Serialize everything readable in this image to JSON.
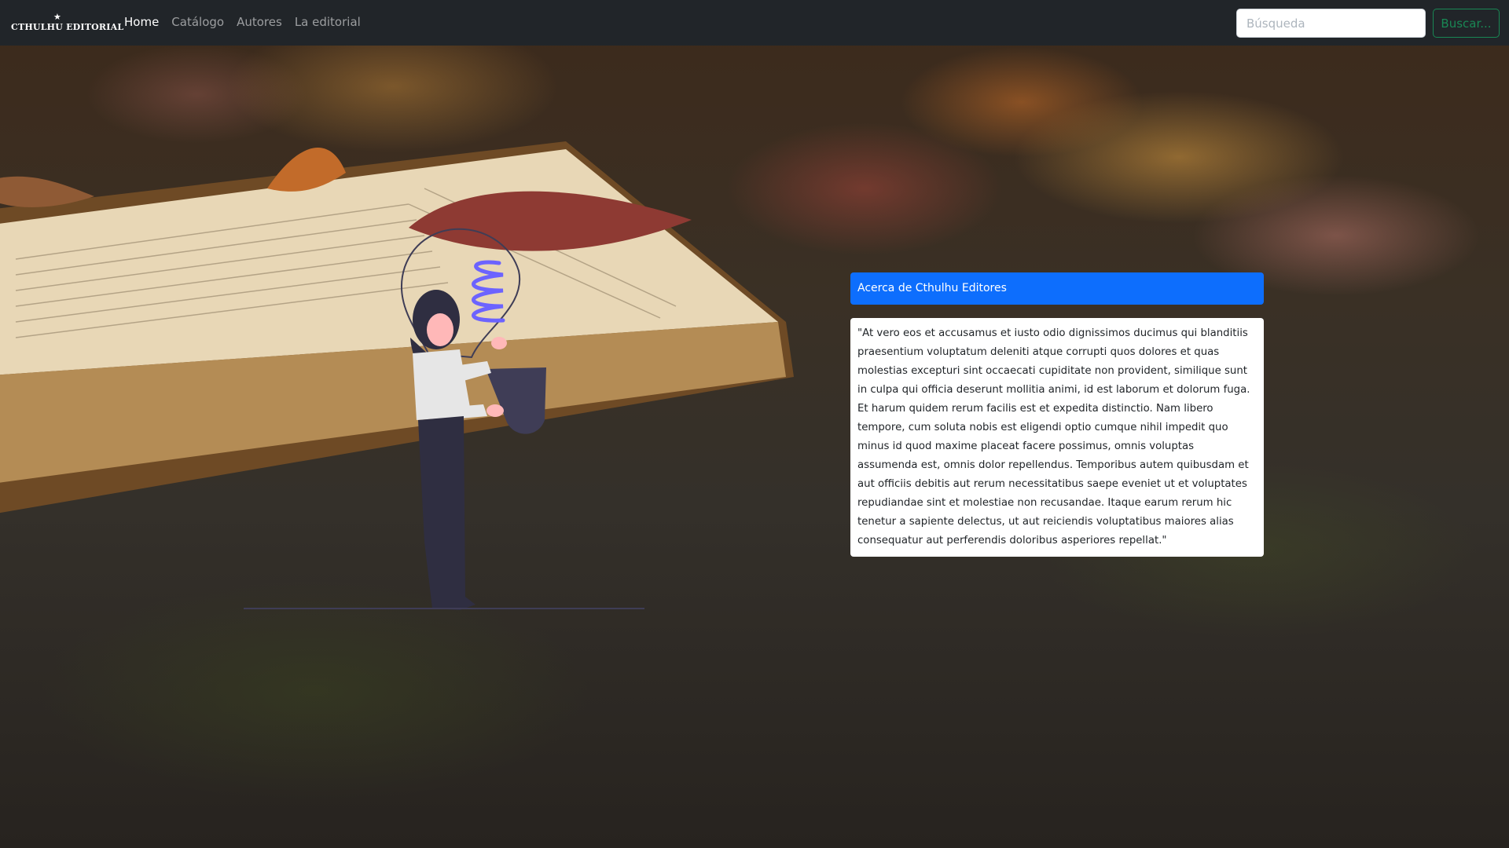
{
  "navbar": {
    "brand": "CTHULHU EDITORIAL",
    "brand_icon": "star-icon",
    "links": [
      {
        "label": "Home",
        "active": true
      },
      {
        "label": "Catálogo",
        "active": false
      },
      {
        "label": "Autores",
        "active": false
      },
      {
        "label": "La editorial",
        "active": false
      }
    ],
    "search": {
      "placeholder": "Búsqueda",
      "value": ""
    },
    "search_button": "Buscar..."
  },
  "card": {
    "header": "Acerca de Cthulhu Editores",
    "body": "\"At vero eos et accusamus et iusto odio dignissimos ducimus qui blanditiis praesentium voluptatum deleniti atque corrupti quos dolores et quas molestias excepturi sint occaecati cupiditate non provident, similique sunt in culpa qui officia deserunt mollitia animi, id est laborum et dolorum fuga. Et harum quidem rerum facilis est et expedita distinctio. Nam libero tempore, cum soluta nobis est eligendi optio cumque nihil impedit quo minus id quod maxime placeat facere possimus, omnis voluptas assumenda est, omnis dolor repellendus. Temporibus autem quibusdam et aut officiis debitis aut rerum necessitatibus saepe eveniet ut et voluptates repudiandae sint et molestiae non recusandae. Itaque earum rerum hic tenetur a sapiente delectus, ut aut reiciendis voluptatibus maiores alias consequatur aut perferendis doloribus asperiores repellat.\""
  },
  "colors": {
    "navbar_bg": "#212529",
    "card_header_bg": "#0d6efd",
    "search_button": "#198754",
    "illustration_accent": "#6c63ff",
    "illustration_dark": "#3f3d56"
  }
}
